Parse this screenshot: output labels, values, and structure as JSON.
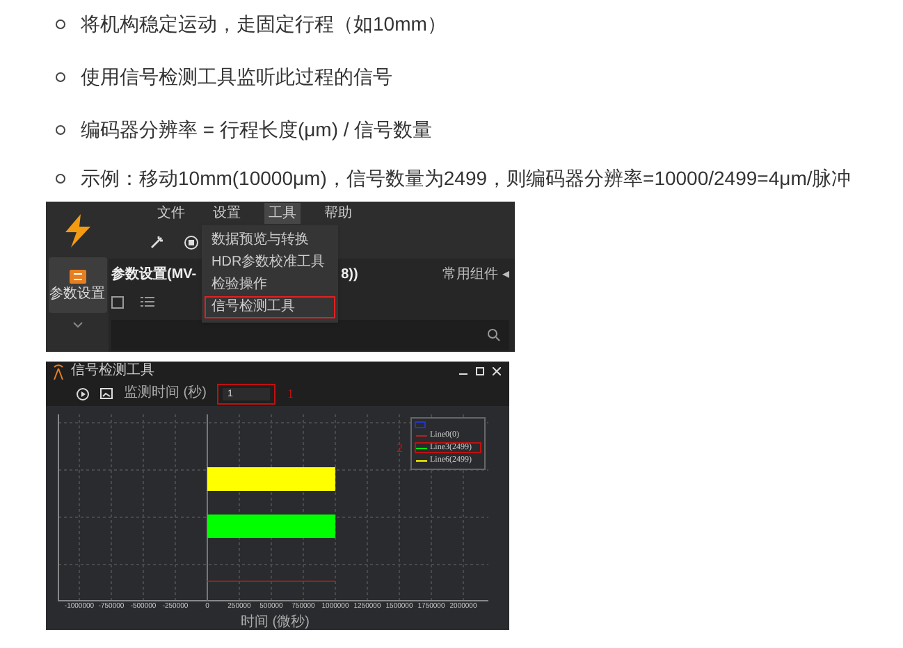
{
  "bullets": [
    "将机构稳定运动，走固定行程（如10mm）",
    "使用信号检测工具监听此过程的信号",
    "编码器分辨率 = 行程长度(μm) / 信号数量",
    "示例：移动10mm(10000μm)，信号数量为2499，则编码器分辨率=10000/2499=4μm/脉冲"
  ],
  "screenshot_1": {
    "menu_bar": [
      {
        "label": "文件",
        "selected": false
      },
      {
        "label": "设置",
        "selected": false
      },
      {
        "label": "工具",
        "selected": true
      },
      {
        "label": "帮助",
        "selected": false
      }
    ],
    "dropdown": [
      {
        "label": "数据预览与转换",
        "highlighted": false
      },
      {
        "label": "HDR参数校准工具",
        "highlighted": false
      },
      {
        "label": "检验操作",
        "highlighted": false
      },
      {
        "label": "信号检测工具",
        "highlighted": true
      }
    ],
    "sidebar_item": "参数设置",
    "panel_title": "参数设置(MV-",
    "panel_title_end": "8))",
    "panel_right": "常用组件 ◂"
  },
  "screenshot_2": {
    "title": "信号检测工具",
    "field_label": "监测时间 (秒)",
    "field_value": "1",
    "callouts": [
      "1",
      "2"
    ],
    "legend": [
      {
        "name": "Line0(0)",
        "color": "#b22222",
        "highlighted": false
      },
      {
        "name": "Line3(2499)",
        "color": "#00ff00",
        "highlighted": true
      },
      {
        "name": "Line6(2499)",
        "color": "#ffff00",
        "highlighted": false
      }
    ],
    "x_ticks": [
      "-1000000",
      "-750000",
      "-500000",
      "-250000",
      "0",
      "250000",
      "500000",
      "750000",
      "1000000",
      "1250000",
      "1500000",
      "1750000",
      "2000000"
    ],
    "xlabel": "时间 (微秒)"
  }
}
